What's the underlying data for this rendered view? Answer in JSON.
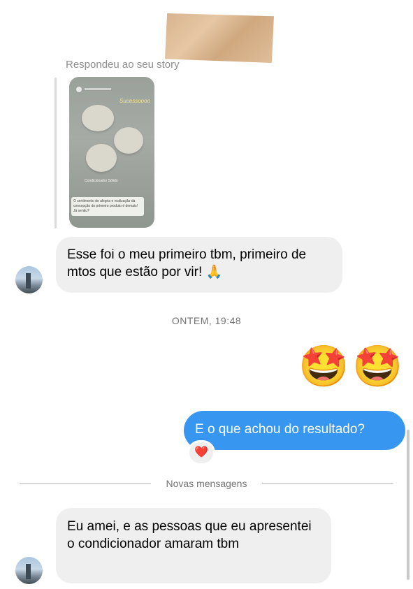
{
  "story_reply": {
    "caption": "Respondeu ao seu story",
    "thumbnail_sticker": "Sucessoooo",
    "thumbnail_mid_text": "Condicionador Sólido",
    "thumbnail_note": "O sentimento de alegria e realização da concepção do primeiro produto é demais! Já sentiu?"
  },
  "messages": [
    {
      "from": "other",
      "text": "Esse foi o meu primeiro tbm, primeiro de mtos que estão por vir! 🙏"
    },
    {
      "from": "timestamp",
      "text": "ONTEM, 19:48"
    },
    {
      "from": "me",
      "text": "🤩🤩"
    },
    {
      "from": "me",
      "text": "E o que achou do resultado?",
      "reaction": "❤️"
    },
    {
      "from": "divider",
      "text": "Novas mensagens"
    },
    {
      "from": "other",
      "text": "Eu amei, e as pessoas que eu apresentei o condicionador amaram tbm"
    }
  ],
  "emoji_big": [
    "🤩",
    "🤩"
  ],
  "reaction_emoji": "❤️",
  "colors": {
    "sent_bubble": "#3797f0",
    "received_bubble": "#efefef",
    "meta_text": "#737373"
  }
}
